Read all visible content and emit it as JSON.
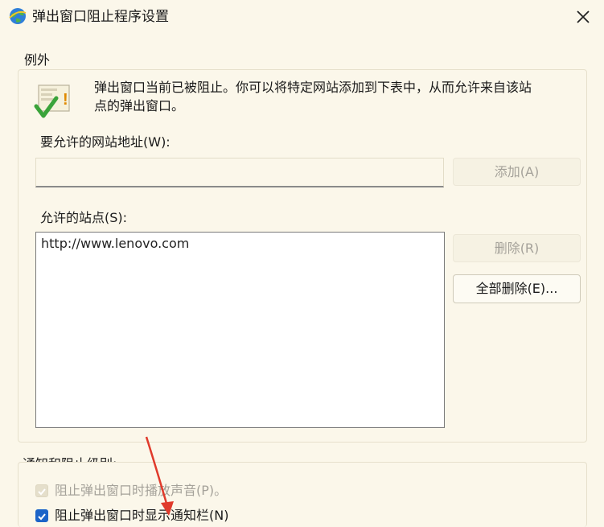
{
  "window": {
    "title": "弹出窗口阻止程序设置",
    "icon": "ie-globe-icon"
  },
  "exceptions": {
    "group_label": "例外",
    "message_line1": "弹出窗口当前已被阻止。你可以将特定网站添加到下表中，从而允许来自该站",
    "message_line2": "点的弹出窗口。",
    "address_label": "要允许的网站地址(W):",
    "address_value": "",
    "add_button": "添加(A)",
    "allowed_label": "允许的站点(S):",
    "allowed_sites": [
      "http://www.lenovo.com"
    ],
    "remove_button": "删除(R)",
    "remove_all_button": "全部删除(E)..."
  },
  "notification": {
    "group_label": "通知和阻止级别:",
    "play_sound_label": "阻止弹出窗口时播放声音(P)。",
    "show_bar_label": "阻止弹出窗口时显示通知栏(N)"
  },
  "colors": {
    "background": "#fbf7ea",
    "checkbox_checked": "#1c64c8",
    "annotation_arrow": "#e03a2b"
  }
}
